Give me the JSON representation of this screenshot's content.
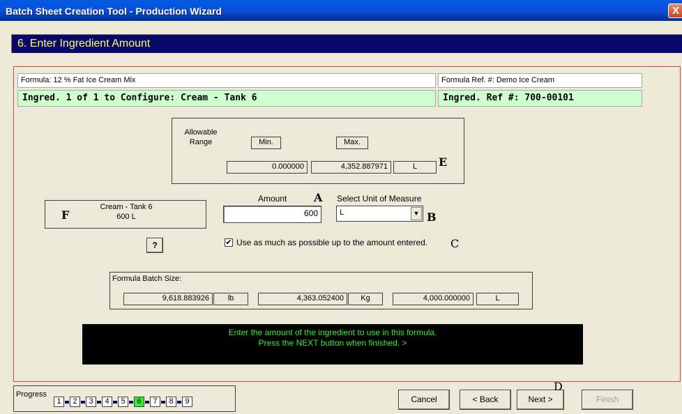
{
  "window": {
    "title": "Batch Sheet Creation Tool - Production Wizard",
    "close_glyph": "X"
  },
  "step_header": "6. Enter Ingredient Amount",
  "formula": {
    "name": "Formula: 12 % Fat Ice Cream Mix",
    "ref": "Formula Ref. #: Demo Ice Cream",
    "ingredient": "Ingred. 1 of 1 to Configure: Cream - Tank 6",
    "ingredient_ref": "Ingred. Ref #: 700-00101"
  },
  "range": {
    "label": "Allowable\nRange",
    "min_label": "Min.",
    "max_label": "Max.",
    "min_value": "0.000000",
    "max_value": "4,352.887971",
    "unit": "L",
    "marker": "E"
  },
  "source": {
    "marker": "F",
    "line1": "Cream - Tank 6",
    "line2": "600 L"
  },
  "amount": {
    "label": "Amount",
    "marker": "A",
    "value": "600"
  },
  "unit_select": {
    "label": "Select Unit of Measure",
    "value": "L",
    "marker": "B",
    "arrow": "▼"
  },
  "help_button": "?",
  "use_max": {
    "checked_glyph": "✔",
    "label": "Use as much as possible up to the amount entered.",
    "marker": "C"
  },
  "batch_size": {
    "label": "Formula Batch Size:",
    "lb_value": "9,618.883926",
    "lb_unit": "lb",
    "kg_value": "4,363.052400",
    "kg_unit": "Kg",
    "l_value": "4,000.000000",
    "l_unit": "L"
  },
  "message": {
    "line1": "Enter the amount of the ingredient to use in this formula.",
    "line2": "Press the NEXT button when finished. >"
  },
  "progress": {
    "label": "Progress",
    "steps": [
      "1",
      "2",
      "3",
      "4",
      "5",
      "6",
      "7",
      "8",
      "9"
    ],
    "current": 6
  },
  "buttons": {
    "cancel": "Cancel",
    "back": "< Back",
    "next": "Next >",
    "finish": "Finish",
    "next_marker": "D"
  },
  "colors": {
    "title_blue": "#0058e6",
    "header_navy": "#08086b",
    "header_text": "#ffff66",
    "green_panel": "#ccffcc",
    "message_text": "#33ee33",
    "frame_red": "#e04040"
  }
}
